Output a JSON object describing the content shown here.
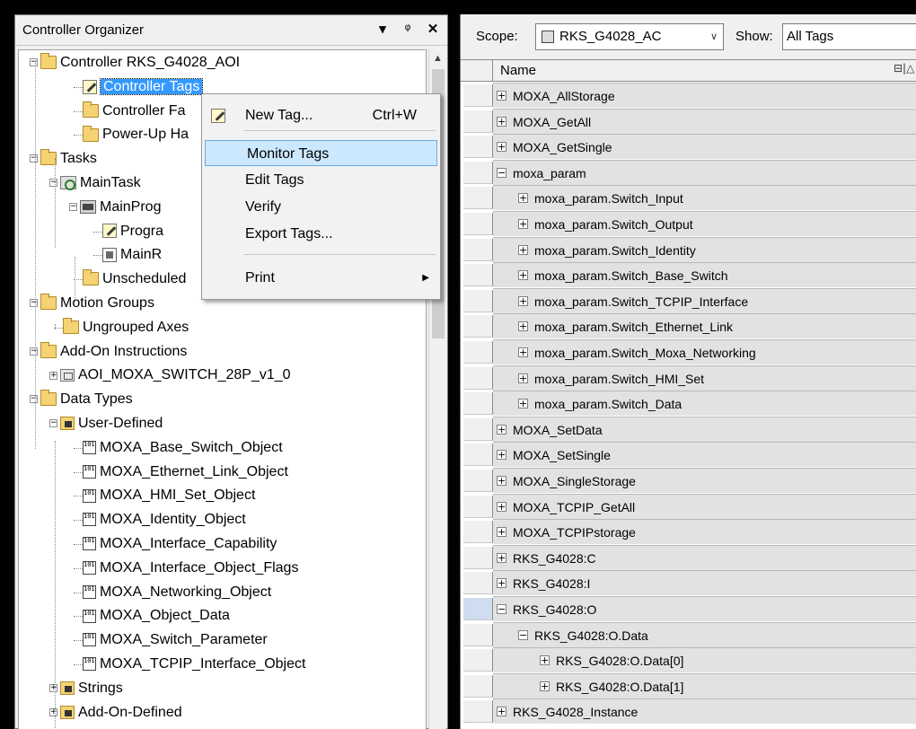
{
  "organizer": {
    "title": "Controller Organizer",
    "pin_btn": "▾",
    "dock_btn": "ᵖ",
    "close_btn": "✕",
    "tree": [
      {
        "label": "Controller RKS_G4028_AOI",
        "icon": "folder-icon",
        "expander": "−"
      },
      {
        "label": "Controller Tags",
        "icon": "tags-icon",
        "selected": true
      },
      {
        "label": "Controller Fa",
        "icon": "folder-icon"
      },
      {
        "label": "Power-Up Ha",
        "icon": "folder-icon"
      },
      {
        "label": "Tasks",
        "icon": "folder-icon",
        "expander": "−"
      },
      {
        "label": "MainTask",
        "icon": "task-icon",
        "expander": "−"
      },
      {
        "label": "MainProg",
        "icon": "prog-icon",
        "expander": "−"
      },
      {
        "label": "Progra",
        "icon": "tags-icon"
      },
      {
        "label": "MainR",
        "icon": "routine-icon"
      },
      {
        "label": "Unscheduled",
        "icon": "folder-icon"
      },
      {
        "label": "Motion Groups",
        "icon": "folder-icon",
        "expander": "−"
      },
      {
        "label": "Ungrouped Axes",
        "icon": "folder-icon"
      },
      {
        "label": "Add-On Instructions",
        "icon": "folder-icon",
        "expander": "−"
      },
      {
        "label": "AOI_MOXA_SWITCH_28P_v1_0",
        "icon": "aoi-icon",
        "expander": "+"
      },
      {
        "label": "Data Types",
        "icon": "folder-icon",
        "expander": "−"
      },
      {
        "label": "User-Defined",
        "icon": "dt-group-icon",
        "expander": "−"
      },
      {
        "label": "MOXA_Base_Switch_Object",
        "icon": "udt-icon"
      },
      {
        "label": "MOXA_Ethernet_Link_Object",
        "icon": "udt-icon"
      },
      {
        "label": "MOXA_HMI_Set_Object",
        "icon": "udt-icon"
      },
      {
        "label": "MOXA_Identity_Object",
        "icon": "udt-icon"
      },
      {
        "label": "MOXA_Interface_Capability",
        "icon": "udt-icon"
      },
      {
        "label": "MOXA_Interface_Object_Flags",
        "icon": "udt-icon"
      },
      {
        "label": "MOXA_Networking_Object",
        "icon": "udt-icon"
      },
      {
        "label": "MOXA_Object_Data",
        "icon": "udt-icon"
      },
      {
        "label": "MOXA_Switch_Parameter",
        "icon": "udt-icon"
      },
      {
        "label": "MOXA_TCPIP_Interface_Object",
        "icon": "udt-icon"
      },
      {
        "label": "Strings",
        "icon": "dt-group-icon",
        "expander": "+"
      },
      {
        "label": "Add-On-Defined",
        "icon": "dt-group-icon",
        "expander": "+"
      }
    ]
  },
  "context_menu": {
    "items": [
      {
        "label": "New Tag...",
        "shortcut": "Ctrl+W",
        "icon": "new-tag-icon"
      },
      {
        "label": "Monitor Tags",
        "highlighted": true
      },
      {
        "label": "Edit Tags"
      },
      {
        "label": "Verify"
      },
      {
        "label": "Export Tags..."
      },
      {
        "label": "Print",
        "submenu_arrow": "▶"
      }
    ]
  },
  "tag_editor": {
    "scope_label": "Scope:",
    "scope_value": "RKS_G4028_AC",
    "scope_dropdown": "∨",
    "show_label": "Show:",
    "show_value": "All Tags",
    "column_name": "Name",
    "column_icons": "⊟|△",
    "rows": [
      {
        "name": "MOXA_AllStorage",
        "expander": "+",
        "level": 0
      },
      {
        "name": "MOXA_GetAll",
        "expander": "+",
        "level": 0
      },
      {
        "name": "MOXA_GetSingle",
        "expander": "+",
        "level": 0
      },
      {
        "name": "moxa_param",
        "expander": "−",
        "level": 0
      },
      {
        "name": "moxa_param.Switch_Input",
        "expander": "+",
        "level": 1
      },
      {
        "name": "moxa_param.Switch_Output",
        "expander": "+",
        "level": 1
      },
      {
        "name": "moxa_param.Switch_Identity",
        "expander": "+",
        "level": 1
      },
      {
        "name": "moxa_param.Switch_Base_Switch",
        "expander": "+",
        "level": 1
      },
      {
        "name": "moxa_param.Switch_TCPIP_Interface",
        "expander": "+",
        "level": 1
      },
      {
        "name": "moxa_param.Switch_Ethernet_Link",
        "expander": "+",
        "level": 1
      },
      {
        "name": "moxa_param.Switch_Moxa_Networking",
        "expander": "+",
        "level": 1
      },
      {
        "name": "moxa_param.Switch_HMI_Set",
        "expander": "+",
        "level": 1
      },
      {
        "name": "moxa_param.Switch_Data",
        "expander": "+",
        "level": 1
      },
      {
        "name": "MOXA_SetData",
        "expander": "+",
        "level": 0
      },
      {
        "name": "MOXA_SetSingle",
        "expander": "+",
        "level": 0
      },
      {
        "name": "MOXA_SingleStorage",
        "expander": "+",
        "level": 0
      },
      {
        "name": "MOXA_TCPIP_GetAll",
        "expander": "+",
        "level": 0
      },
      {
        "name": "MOXA_TCPIPstorage",
        "expander": "+",
        "level": 0
      },
      {
        "name": "RKS_G4028:C",
        "expander": "+",
        "level": 0
      },
      {
        "name": "RKS_G4028:I",
        "expander": "+",
        "level": 0
      },
      {
        "name": "RKS_G4028:O",
        "expander": "−",
        "level": 0,
        "row_selected": true
      },
      {
        "name": "RKS_G4028:O.Data",
        "expander": "−",
        "level": 1
      },
      {
        "name": "RKS_G4028:O.Data[0]",
        "expander": "+",
        "level": 2
      },
      {
        "name": "RKS_G4028:O.Data[1]",
        "expander": "+",
        "level": 2
      },
      {
        "name": "RKS_G4028_Instance",
        "expander": "+",
        "level": 0
      }
    ]
  },
  "colors": {
    "selection": "#3399ff",
    "menu_highlight": "#cce8ff",
    "grid_row": "#e2e2e2",
    "folder": "#f5d272"
  }
}
